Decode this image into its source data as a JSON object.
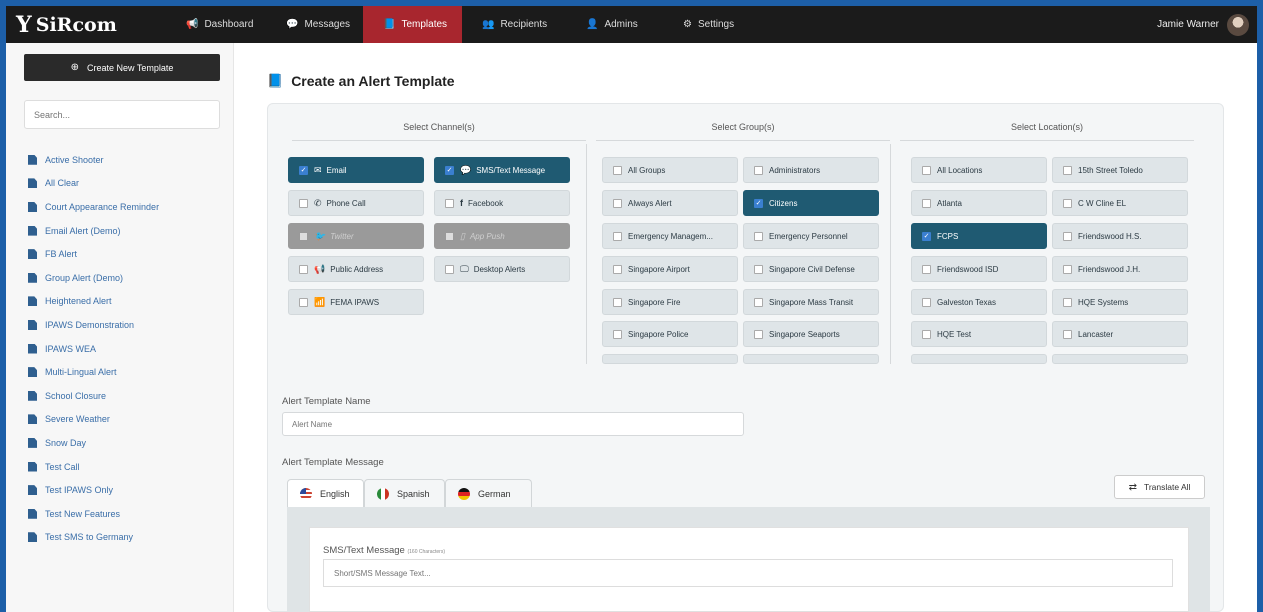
{
  "brand": {
    "name": "SiRcom"
  },
  "nav": {
    "items": [
      {
        "label": "Dashboard",
        "icon": "bullhorn-icon"
      },
      {
        "label": "Messages",
        "icon": "chat-icon"
      },
      {
        "label": "Templates",
        "icon": "book-icon",
        "active": true
      },
      {
        "label": "Recipients",
        "icon": "users-icon"
      },
      {
        "label": "Admins",
        "icon": "user-icon"
      },
      {
        "label": "Settings",
        "icon": "gear-icon"
      }
    ],
    "user_name": "Jamie Warner"
  },
  "sidebar": {
    "create_label": "Create New Template",
    "search_placeholder": "Search...",
    "templates": [
      "Active Shooter",
      "All Clear",
      "Court Appearance Reminder",
      "Email Alert (Demo)",
      "FB Alert",
      "Group Alert (Demo)",
      "Heightened Alert",
      "IPAWS Demonstration",
      "IPAWS WEA",
      "Multi-Lingual Alert",
      "School Closure",
      "Severe Weather",
      "Snow Day",
      "Test Call",
      "Test IPAWS Only",
      "Test New Features",
      "Test SMS to Germany"
    ]
  },
  "main": {
    "title": "Create an Alert Template",
    "channels": {
      "heading": "Select Channel(s)",
      "items": [
        {
          "label": "Email",
          "checked": true,
          "disabled": false
        },
        {
          "label": "SMS/Text Message",
          "checked": true,
          "disabled": false
        },
        {
          "label": "Phone Call",
          "checked": false,
          "disabled": false
        },
        {
          "label": "Facebook",
          "checked": false,
          "disabled": false
        },
        {
          "label": "Twitter",
          "checked": false,
          "disabled": true
        },
        {
          "label": "App Push",
          "checked": false,
          "disabled": true
        },
        {
          "label": "Public Address",
          "checked": false,
          "disabled": false
        },
        {
          "label": "Desktop Alerts",
          "checked": false,
          "disabled": false
        },
        {
          "label": "FEMA IPAWS",
          "checked": false,
          "disabled": false
        }
      ]
    },
    "groups": {
      "heading": "Select Group(s)",
      "items": [
        {
          "label": "All Groups",
          "checked": false
        },
        {
          "label": "Administrators",
          "checked": false
        },
        {
          "label": "Always Alert",
          "checked": false
        },
        {
          "label": "Citizens",
          "checked": true
        },
        {
          "label": "Emergency Managem...",
          "checked": false
        },
        {
          "label": "Emergency Personnel",
          "checked": false
        },
        {
          "label": "Singapore Airport",
          "checked": false
        },
        {
          "label": "Singapore Civil Defense",
          "checked": false
        },
        {
          "label": "Singapore Fire",
          "checked": false
        },
        {
          "label": "Singapore Mass Transit",
          "checked": false
        },
        {
          "label": "Singapore Police",
          "checked": false
        },
        {
          "label": "Singapore Seaports",
          "checked": false
        }
      ]
    },
    "locations": {
      "heading": "Select Location(s)",
      "items": [
        {
          "label": "All Locations",
          "checked": false
        },
        {
          "label": "15th Street Toledo",
          "checked": false
        },
        {
          "label": "Atlanta",
          "checked": false
        },
        {
          "label": "C W Cline EL",
          "checked": false
        },
        {
          "label": "FCPS",
          "checked": true
        },
        {
          "label": "Friendswood H.S.",
          "checked": false
        },
        {
          "label": "Friendswood ISD",
          "checked": false
        },
        {
          "label": "Friendswood J.H.",
          "checked": false
        },
        {
          "label": "Galveston Texas",
          "checked": false
        },
        {
          "label": "HQE Systems",
          "checked": false
        },
        {
          "label": "HQE Test",
          "checked": false
        },
        {
          "label": "Lancaster",
          "checked": false
        }
      ]
    },
    "name_label": "Alert Template Name",
    "name_placeholder": "Alert Name",
    "message_label": "Alert Template Message",
    "language_tabs": [
      "English",
      "Spanish",
      "German"
    ],
    "translate_label": "Translate All",
    "sms_label": "SMS/Text Message",
    "sms_hint": "(160 Characters)",
    "sms_placeholder": "Short/SMS Message Text..."
  }
}
